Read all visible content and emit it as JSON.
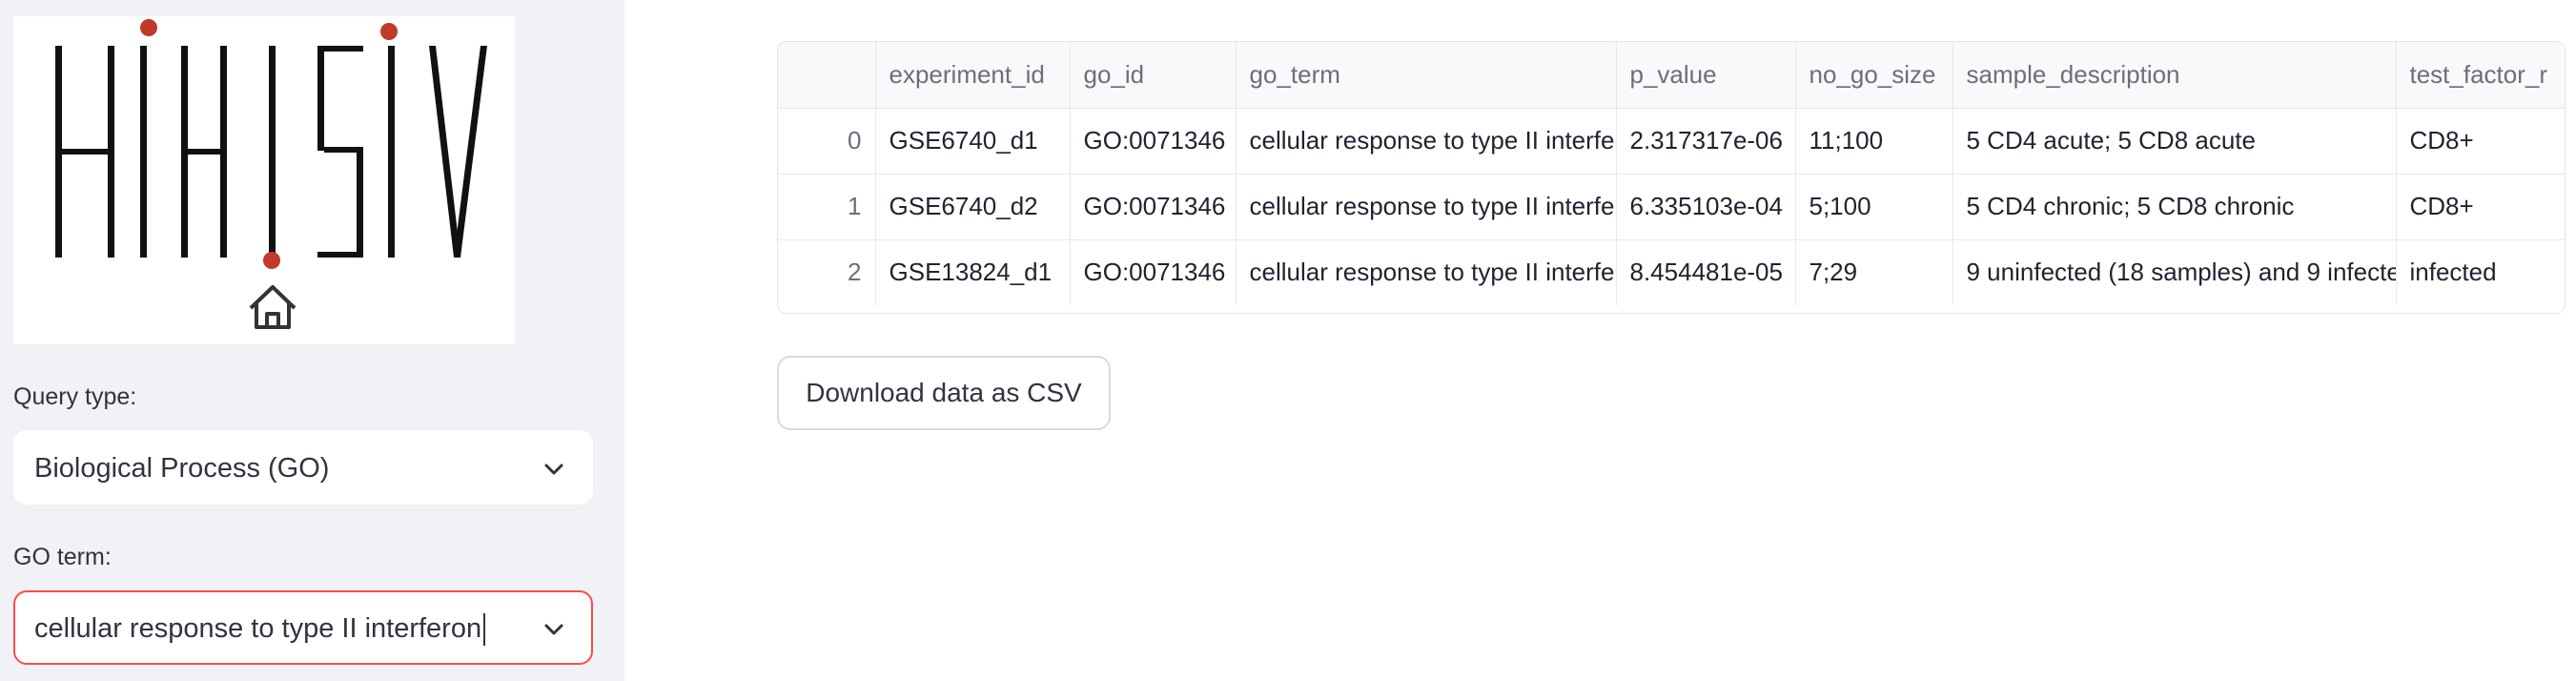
{
  "sidebar": {
    "query_type": {
      "label": "Query type:",
      "value": "Biological Process (GO)"
    },
    "go_term": {
      "label": "GO term:",
      "value": "cellular response to type II interferon"
    }
  },
  "table": {
    "columns": [
      "",
      "experiment_id",
      "go_id",
      "go_term",
      "p_value",
      "no_go_size",
      "sample_description",
      "test_factor_r"
    ],
    "rows": [
      [
        "0",
        "GSE6740_d1",
        "GO:0071346",
        "cellular response to type II interfe",
        "2.317317e-06",
        "11;100",
        "5 CD4 acute; 5 CD8 acute",
        "CD8+"
      ],
      [
        "1",
        "GSE6740_d2",
        "GO:0071346",
        "cellular response to type II interfe",
        "6.335103e-04",
        "5;100",
        "5 CD4 chronic; 5 CD8 chronic",
        "CD8+"
      ],
      [
        "2",
        "GSE13824_d1",
        "GO:0071346",
        "cellular response to type II interfe",
        "8.454481e-05",
        "7;29",
        "9 uninfected (18 samples) and 9 infecte",
        "infected"
      ]
    ]
  },
  "download_button": {
    "label": "Download data as CSV"
  },
  "colors": {
    "sidebar_bg": "#f0f2f6",
    "focus_border": "#ff4b4b",
    "logo_dot": "#c0392b"
  },
  "icons": {
    "home": "home-icon",
    "chevron": "chevron-down-icon"
  }
}
